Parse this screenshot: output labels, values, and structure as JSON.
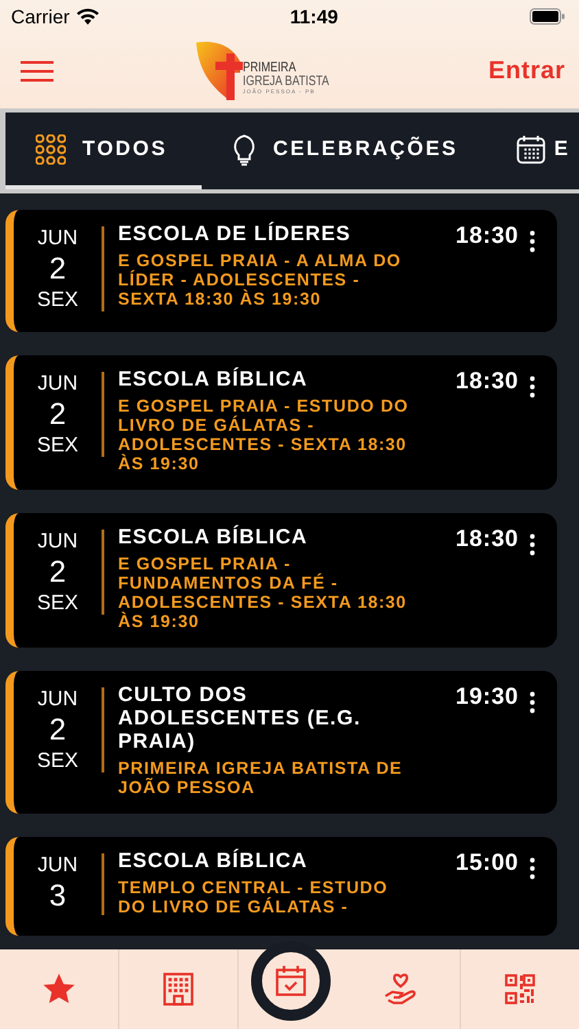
{
  "status_bar": {
    "carrier": "Carrier",
    "time": "11:49"
  },
  "header": {
    "logo": {
      "line1": "PRIMEIRA",
      "line2": "IGREJA BATISTA",
      "line3": "JOÃO PESSOA - PB"
    },
    "login": "Entrar"
  },
  "tabs": [
    {
      "label": "TODOS",
      "selected": true
    },
    {
      "label": "CELEBRAÇÕES",
      "selected": false
    },
    {
      "label": "E",
      "selected": false
    }
  ],
  "events": [
    {
      "month": "JUN",
      "day": "2",
      "weekday": "SEX",
      "title": "ESCOLA DE LÍDERES",
      "description": "E GOSPEL PRAIA - A ALMA DO LÍDER - ADOLESCENTES - SEXTA 18:30 ÀS 19:30",
      "time": "18:30"
    },
    {
      "month": "JUN",
      "day": "2",
      "weekday": "SEX",
      "title": "ESCOLA BÍBLICA",
      "description": "E GOSPEL PRAIA - ESTUDO DO LIVRO DE GÁLATAS - ADOLESCENTES - SEXTA 18:30 ÀS 19:30",
      "time": "18:30"
    },
    {
      "month": "JUN",
      "day": "2",
      "weekday": "SEX",
      "title": "ESCOLA BÍBLICA",
      "description": "E GOSPEL PRAIA - FUNDAMENTOS DA FÉ - ADOLESCENTES - SEXTA 18:30 ÀS 19:30",
      "time": "18:30"
    },
    {
      "month": "JUN",
      "day": "2",
      "weekday": "SEX",
      "title": "CULTO DOS ADOLESCENTES (E.G. PRAIA)",
      "description": "PRIMEIRA IGREJA BATISTA DE JOÃO PESSOA",
      "time": "19:30"
    },
    {
      "month": "JUN",
      "day": "3",
      "title": "ESCOLA BÍBLICA",
      "description": "TEMPLO CENTRAL - ESTUDO DO LIVRO DE GÁLATAS -",
      "time": "15:00"
    }
  ],
  "bottom_nav": [
    {
      "selected": false
    },
    {
      "selected": false
    },
    {
      "selected": true
    },
    {
      "selected": false
    },
    {
      "selected": false
    }
  ]
}
